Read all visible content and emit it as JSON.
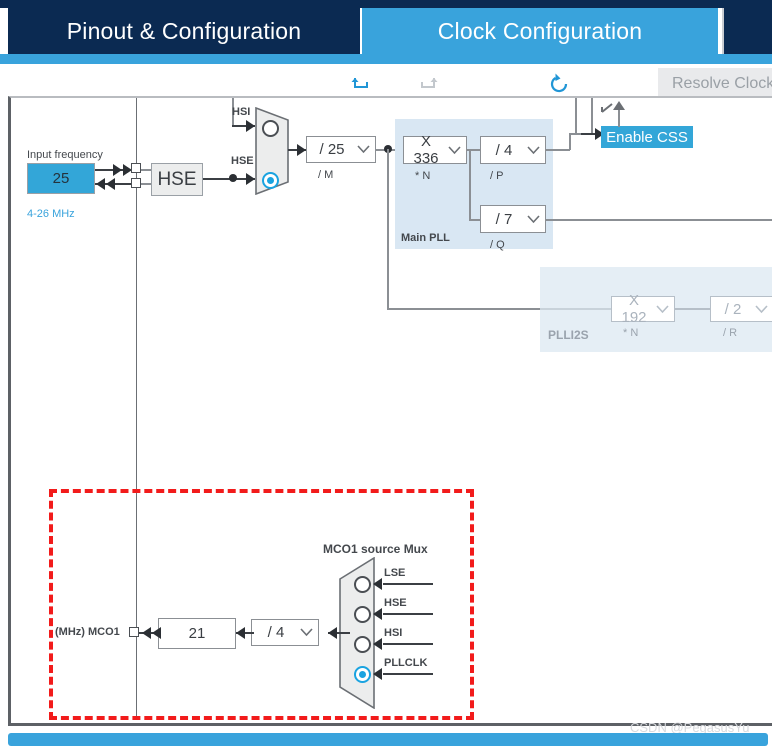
{
  "app": {
    "tabs": [
      {
        "label": "Pinout & Configuration",
        "state": "inactive"
      },
      {
        "label": "Clock Configuration",
        "state": "active"
      },
      {
        "label": "",
        "state": "inactive"
      }
    ]
  },
  "toolbar": {
    "undo_icon": "undo-icon",
    "redo_icon": "redo-icon",
    "reset_icon": "reset-icon",
    "resolve_label": "Resolve Clock"
  },
  "clock_tree": {
    "input": {
      "caption": "Input frequency",
      "value": "25",
      "range": "4-26 MHz"
    },
    "hse_block": {
      "label": "HSE"
    },
    "pll_source_mux": {
      "inputs": [
        {
          "label": "HSI",
          "selected": false
        },
        {
          "label": "HSE",
          "selected": true
        }
      ]
    },
    "pll_m": {
      "value": "/ 25",
      "caption": "/ M"
    },
    "main_pll": {
      "title": "Main PLL",
      "n": {
        "value": "X 336",
        "caption": "* N"
      },
      "p": {
        "value": "/ 4",
        "caption": "/ P"
      },
      "q": {
        "value": "/ 7",
        "caption": "/ Q"
      }
    },
    "plli2s": {
      "title": "PLLI2S",
      "n": {
        "value": "X 192",
        "caption": "* N"
      },
      "r": {
        "value": "/ 2",
        "caption": "/ R"
      }
    },
    "css": {
      "label": "Enable CSS"
    },
    "mco1": {
      "mux_title": "MCO1 source Mux",
      "sources": [
        {
          "label": "LSE",
          "selected": false
        },
        {
          "label": "HSE",
          "selected": false
        },
        {
          "label": "HSI",
          "selected": false
        },
        {
          "label": "PLLCLK",
          "selected": true
        }
      ],
      "divider": {
        "value": "/ 4"
      },
      "output_value": "21",
      "output_label": "(MHz) MCO1"
    }
  },
  "watermark": {
    "text": "CSDN @PegasusYu"
  },
  "colors": {
    "tab_dark": "#0b2a52",
    "tab_active": "#39a3dc",
    "accent": "#33a6d8",
    "pll_group": "#d9e7f3",
    "highlight": "#f21b1b"
  }
}
